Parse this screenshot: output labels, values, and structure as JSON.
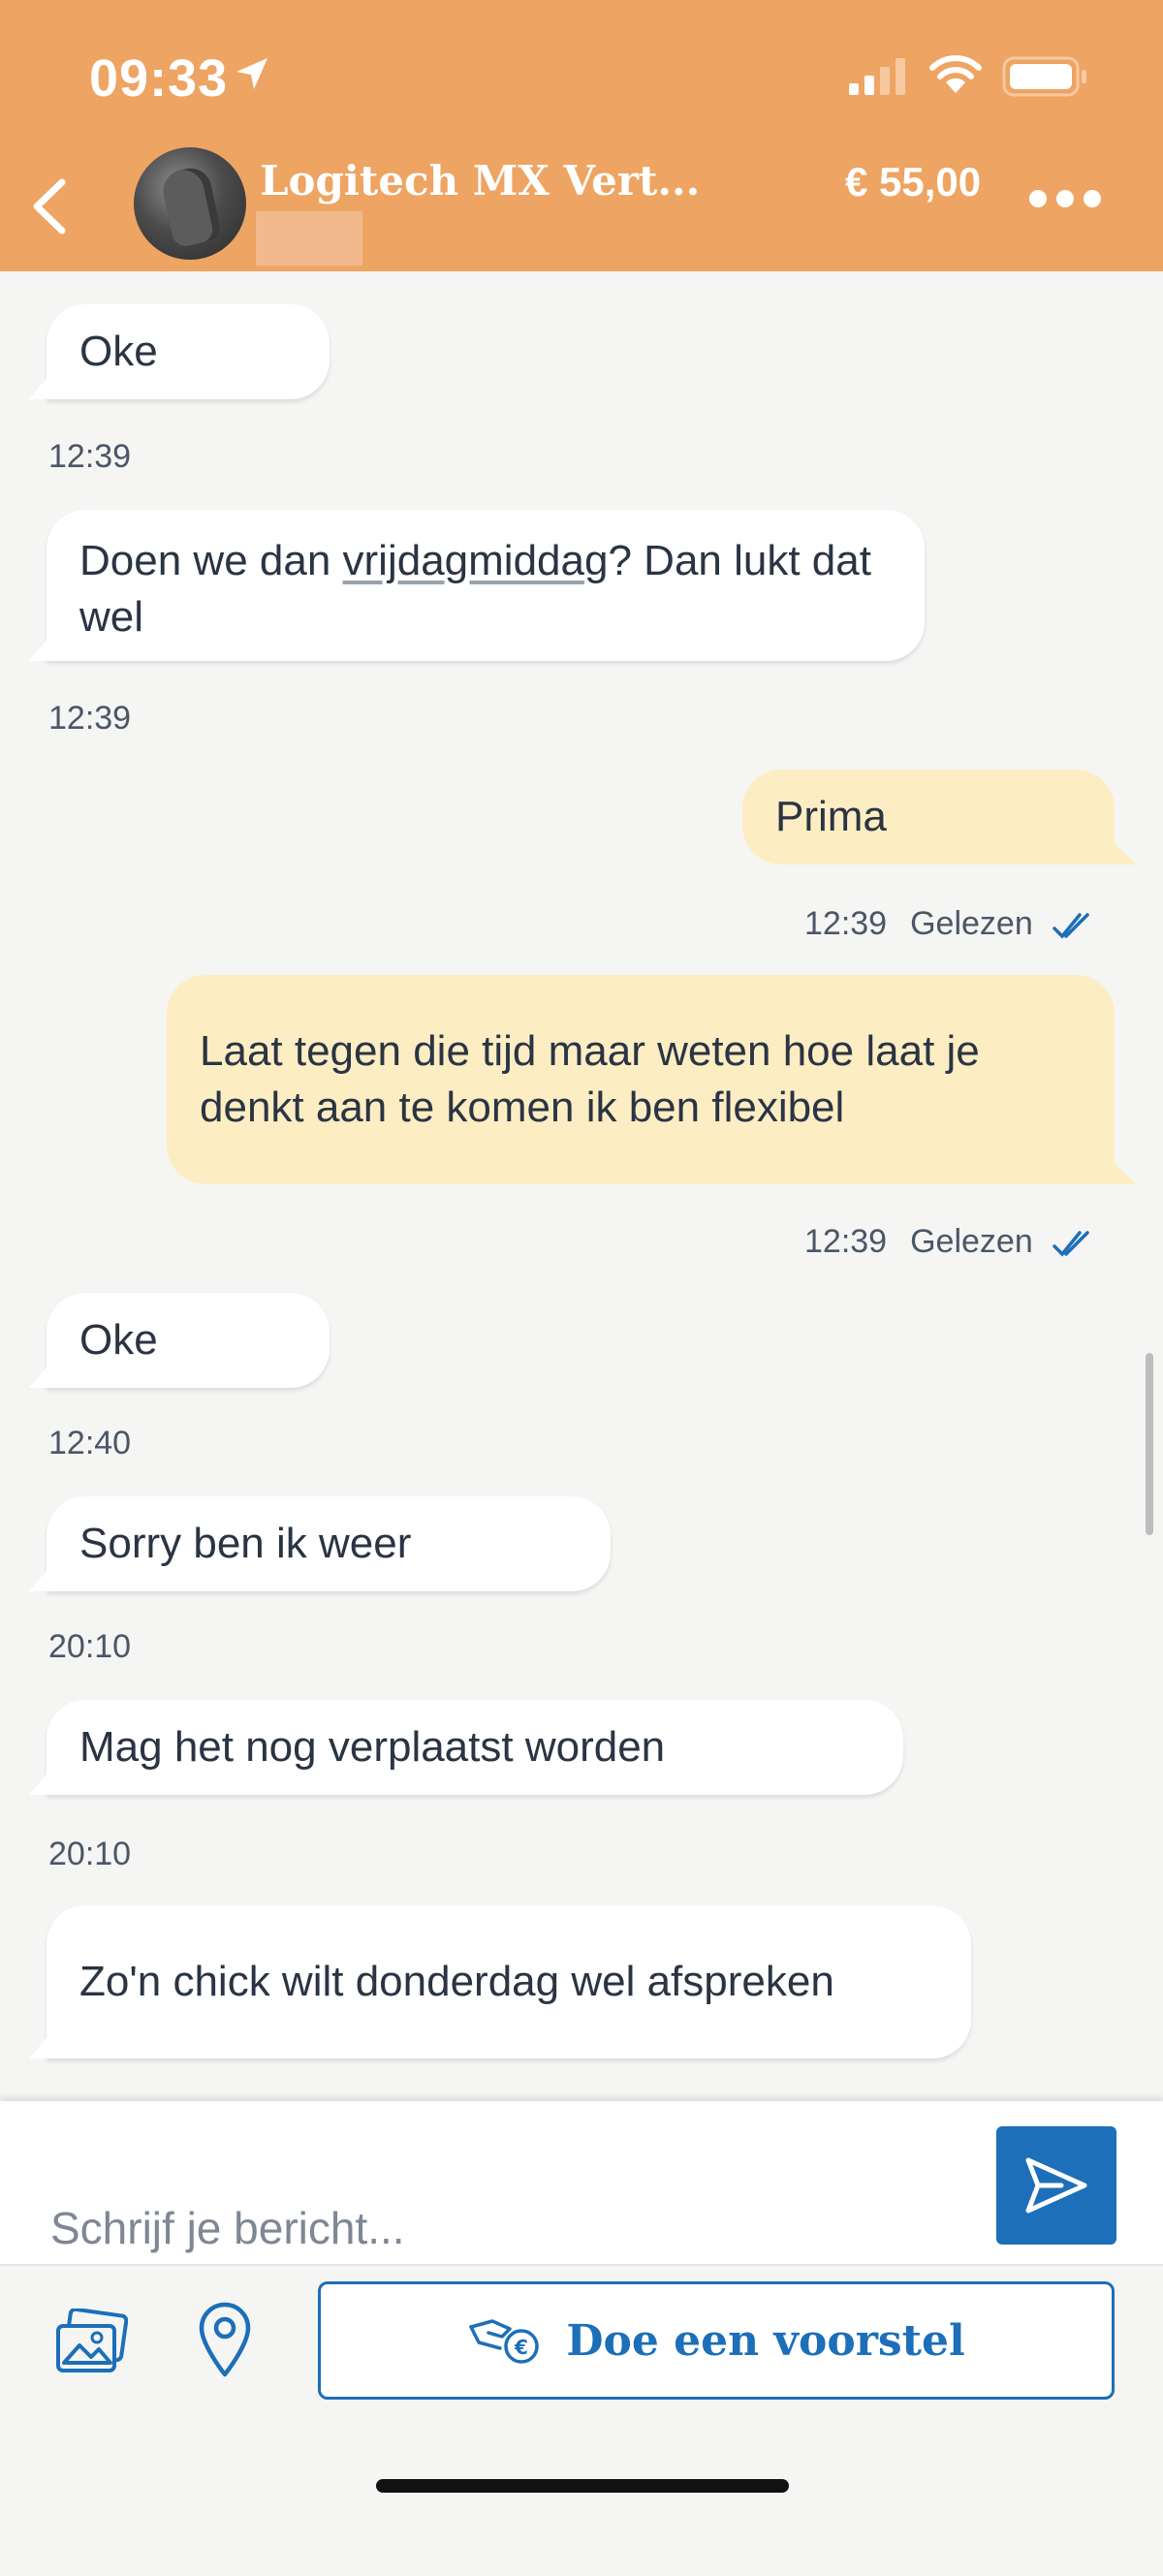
{
  "status_bar": {
    "time": "09:33"
  },
  "header": {
    "title": "Logitech MX Vert...",
    "price": "€ 55,00"
  },
  "messages": [
    {
      "side": "in",
      "text": "Oke",
      "time": "12:39"
    },
    {
      "side": "in",
      "text_before": "Doen we dan ",
      "text_link": "vrijdagmiddag",
      "text_after": "? Dan lukt dat wel",
      "time": "12:39"
    },
    {
      "side": "out",
      "text": "Prima",
      "time": "12:39",
      "status": "Gelezen"
    },
    {
      "side": "out",
      "text": "Laat tegen die tijd maar weten hoe laat je denkt aan te komen ik ben flexibel",
      "time": "12:39",
      "status": "Gelezen"
    },
    {
      "side": "in",
      "text": "Oke",
      "time": "12:40"
    },
    {
      "side": "in",
      "text": "Sorry ben ik weer",
      "time": "20:10"
    },
    {
      "side": "in",
      "text": "Mag het nog verplaatst worden",
      "time": "20:10"
    },
    {
      "side": "in",
      "text": "Zo'n chick wilt donderdag wel afspreken"
    }
  ],
  "composer": {
    "placeholder": "Schrijf je bericht...",
    "offer_label": "Doe een voorstel"
  },
  "colors": {
    "header": "#eea462",
    "accent": "#1c6fb8",
    "outgoing_bubble": "#fdedc3",
    "incoming_bubble": "#ffffff"
  },
  "icons": [
    "location-arrow-icon",
    "signal-icon",
    "wifi-icon",
    "battery-icon",
    "back-arrow-icon",
    "more-dots-icon",
    "read-check-icon",
    "send-icon",
    "photo-icon",
    "location-pin-icon",
    "offer-hand-icon"
  ]
}
